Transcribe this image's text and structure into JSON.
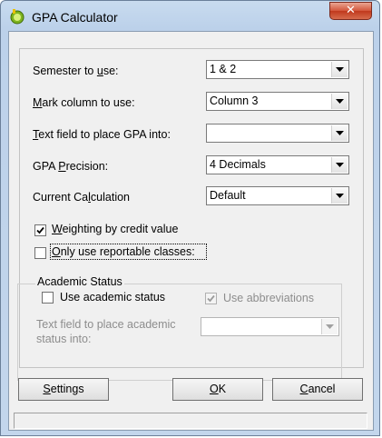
{
  "window": {
    "title": "GPA Calculator",
    "close_label": "✕"
  },
  "fields": {
    "semester": {
      "label_pre": "Semester to ",
      "label_ul": "u",
      "label_post": "se:",
      "value": "1 & 2"
    },
    "mark_column": {
      "label_pre": "",
      "label_ul": "M",
      "label_post": "ark column to use:",
      "value": "Column 3"
    },
    "text_field": {
      "label_pre": "",
      "label_ul": "T",
      "label_post": "ext field to place GPA into:",
      "value": ""
    },
    "precision": {
      "label_pre": "GPA ",
      "label_ul": "P",
      "label_post": "recision:",
      "value": "4 Decimals"
    },
    "calculation": {
      "label_pre": "Current Ca",
      "label_ul": "l",
      "label_post": "culation",
      "value": "Default"
    }
  },
  "checkboxes": {
    "weighting": {
      "label_pre": "",
      "label_ul": "W",
      "label_post": "eighting by credit value",
      "checked": true
    },
    "reportable": {
      "label_pre": "",
      "label_ul": "O",
      "label_post": "nly use reportable classes:",
      "checked": false
    }
  },
  "academic_status": {
    "title": "Academic Status",
    "use_status_label": "Use academic status",
    "use_abbrev_label": "Use abbreviations",
    "text_field_label_line1": "Text field to place academic",
    "text_field_label_line2": "status into:",
    "text_field_value": ""
  },
  "buttons": {
    "settings": {
      "pre": "",
      "ul": "S",
      "post": "ettings"
    },
    "ok": {
      "pre": "",
      "ul": "O",
      "post": "K"
    },
    "cancel": {
      "pre": "",
      "ul": "C",
      "post": "ancel"
    }
  },
  "colors": {
    "titlebar": "#c8dbef",
    "close": "#c0391d",
    "dialog_bg": "#f0f0f0"
  }
}
